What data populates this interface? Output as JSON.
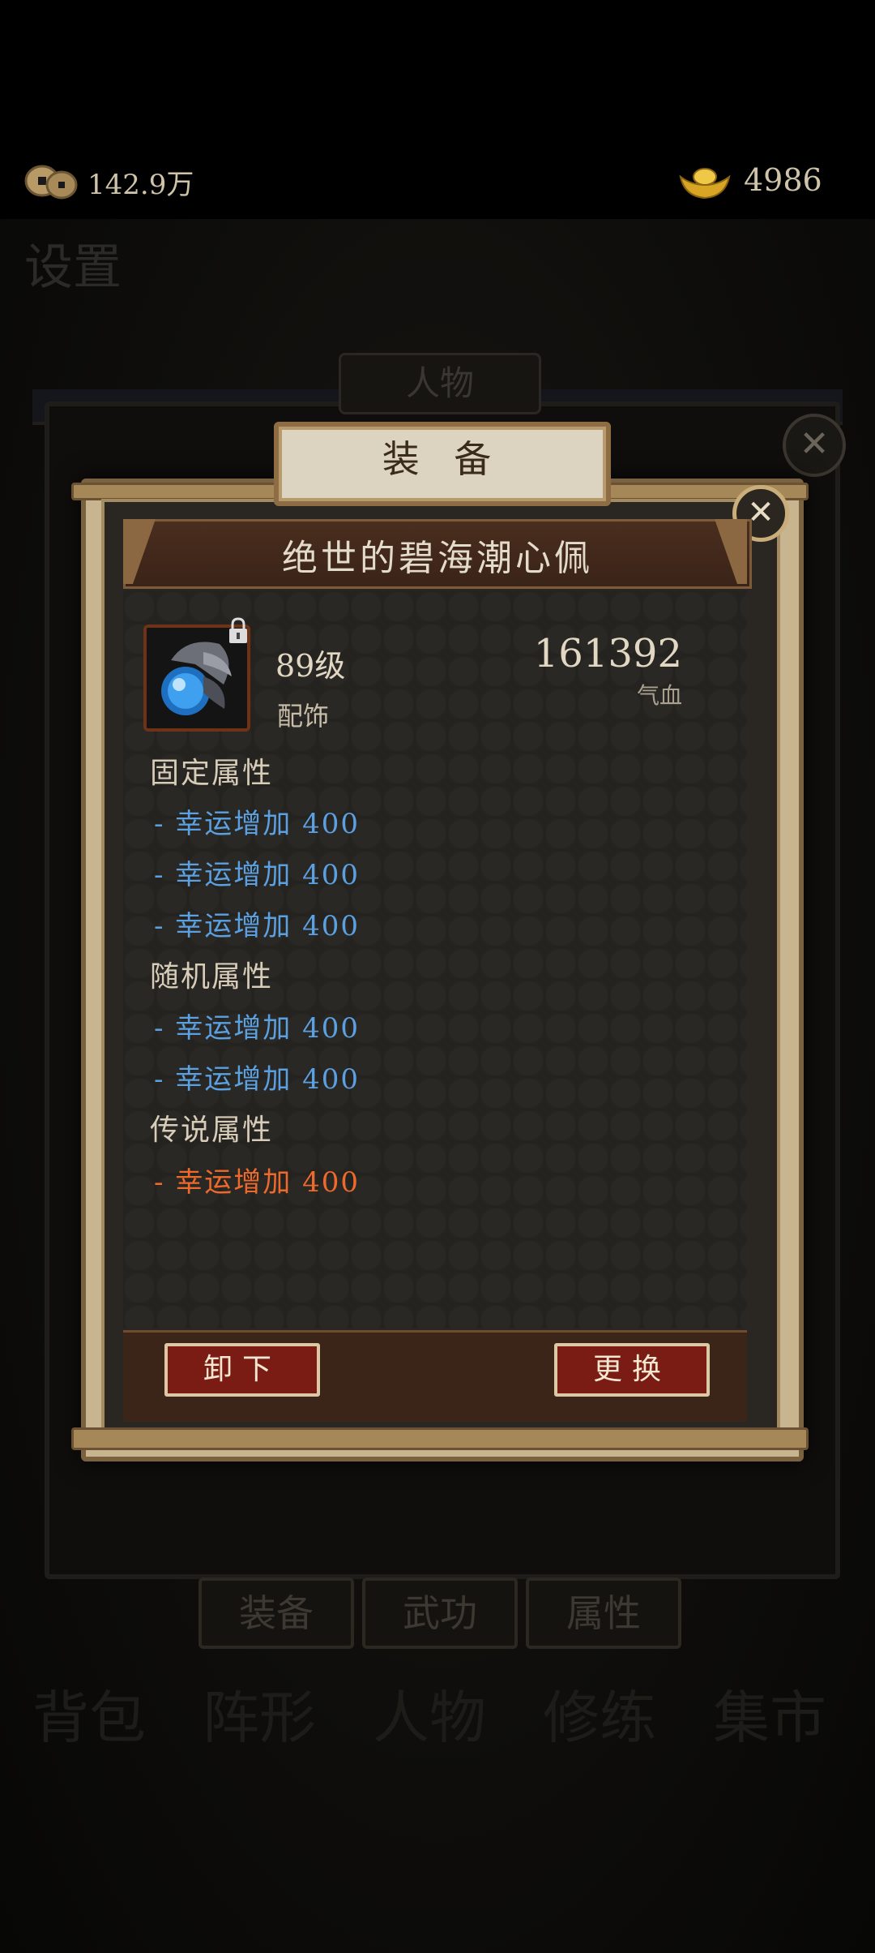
{
  "currency": {
    "coins": "142.9万",
    "ingots": "4986"
  },
  "background": {
    "settings_label": "设置",
    "person_tab": "人物",
    "bottom_tabs": [
      "装备",
      "武功",
      "属性"
    ],
    "nav": [
      "背包",
      "阵形",
      "人物",
      "修练",
      "集市"
    ]
  },
  "modal": {
    "header": "装 备",
    "close_symbol": "✕",
    "item_name": "绝世的碧海潮心佩",
    "level": "89级",
    "slot": "配饰",
    "hp_value": "161392",
    "hp_label": "气血",
    "fixed_title": "固定属性",
    "fixed_attrs": [
      "- 幸运增加 400",
      "- 幸运增加 400",
      "- 幸运增加 400"
    ],
    "random_title": "随机属性",
    "random_attrs": [
      "- 幸运增加 400",
      "- 幸运增加 400"
    ],
    "legend_title": "传说属性",
    "legend_attrs": [
      "- 幸运增加 400"
    ],
    "unequip_label": "卸下",
    "swap_label": "更换"
  },
  "colors": {
    "normal_attr": "#5ba0e0",
    "legend_attr": "#ee6a2c",
    "button_red": "#7a1c14"
  },
  "icons": {
    "coin": "coin-icon",
    "ingot": "gold-ingot-icon",
    "lock": "lock-icon",
    "close": "close-icon",
    "item": "pendant-item-icon"
  }
}
